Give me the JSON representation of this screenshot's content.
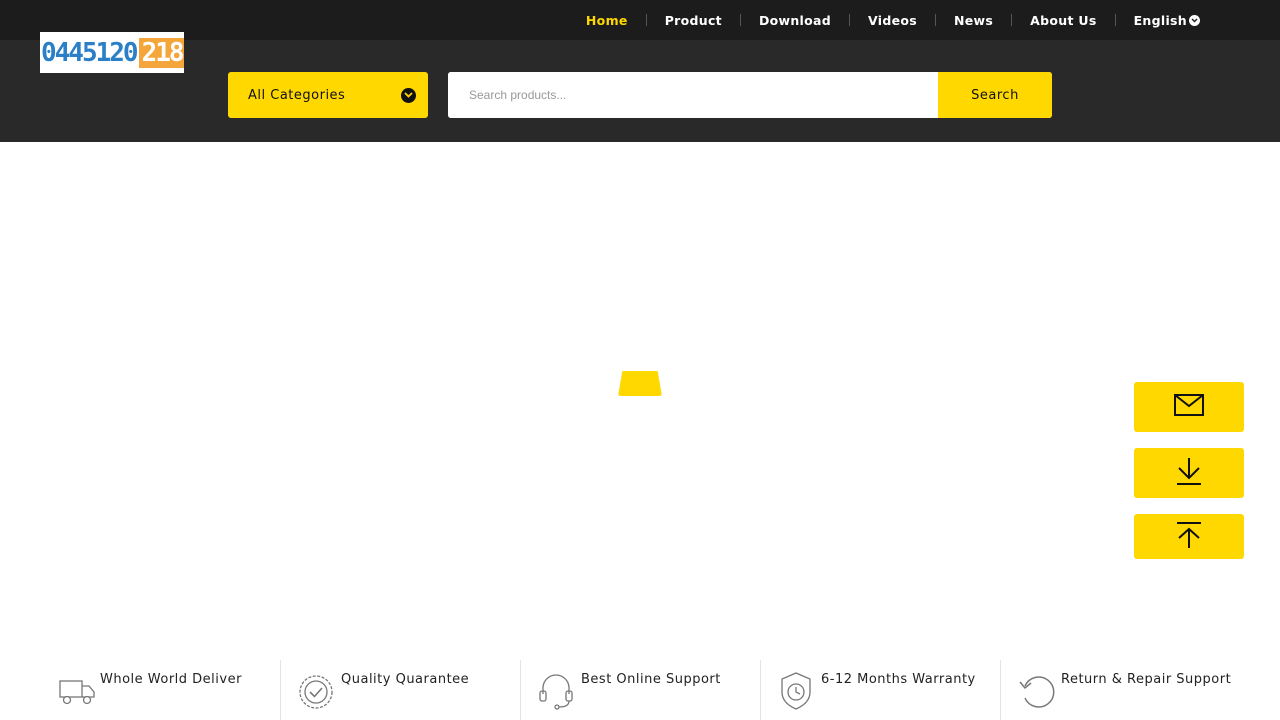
{
  "topnav": {
    "items": [
      {
        "label": "Home",
        "active": true
      },
      {
        "label": "Product"
      },
      {
        "label": "Download"
      },
      {
        "label": "Videos"
      },
      {
        "label": "News"
      },
      {
        "label": "About Us"
      }
    ],
    "language": "English"
  },
  "header": {
    "logo_blue": "0445120",
    "logo_orange": "218",
    "category_label": "All Categories",
    "search_placeholder": "Search products...",
    "search_button": "Search"
  },
  "side_buttons": [
    "mail-icon",
    "download-icon",
    "back-to-top-icon"
  ],
  "features": [
    {
      "label": "Whole World Deliver",
      "icon": "truck-icon"
    },
    {
      "label": "Quality Quarantee",
      "icon": "check-badge-icon"
    },
    {
      "label": "Best Online Support",
      "icon": "headset-icon"
    },
    {
      "label": "6-12 Months Warranty",
      "icon": "shield-clock-icon"
    },
    {
      "label": "Return & Repair Support",
      "icon": "return-arrow-icon"
    }
  ],
  "colors": {
    "accent": "#ffd800",
    "topbar": "#1c1c1c",
    "header": "#292929"
  }
}
